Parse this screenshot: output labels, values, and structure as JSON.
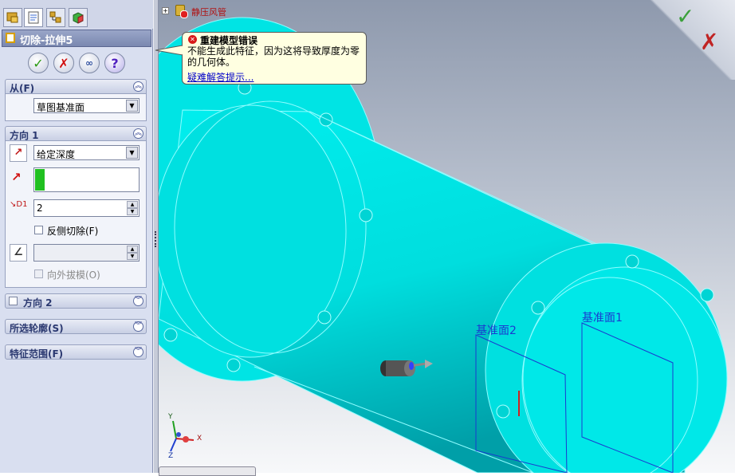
{
  "feature_manager": {
    "tabs": [
      "feature-tree",
      "property-manager",
      "configuration-manager",
      "dimxpert-manager"
    ],
    "title": "切除-拉伸5",
    "buttons": {
      "ok": "✓",
      "cancel": "✗",
      "preview": "∞",
      "help": "?"
    }
  },
  "from_group": {
    "title": "从(F)",
    "selection": "草图基准面"
  },
  "direction1_group": {
    "title": "方向 1",
    "end_condition": "给定深度",
    "depth_value": "2",
    "flip_side_label": "反侧切除(F)",
    "draft_label": "向外拔模(O)"
  },
  "collapsed_groups": {
    "direction2": "方向 2",
    "selected_contours": "所选轮廓(S)",
    "feature_scope": "特征范围(F)"
  },
  "graphics": {
    "tree_node_name": "静压风管",
    "plane_labels": [
      "基准面2",
      "基准面1"
    ],
    "triad_axes": {
      "x": "X",
      "y": "Y",
      "z": "Z"
    },
    "confirm_corner": {
      "ok": "✓",
      "cancel": "✗"
    }
  },
  "error_tip": {
    "title": "重建模型错误",
    "message": "不能生成此特征，因为这将导致厚度为零的几何体。",
    "link": "疑难解答提示..."
  },
  "colors": {
    "model": "#00e4e4",
    "model_edge": "#7ffaff",
    "accent_header": "#2a3870",
    "tip_bg": "#ffffe1"
  }
}
